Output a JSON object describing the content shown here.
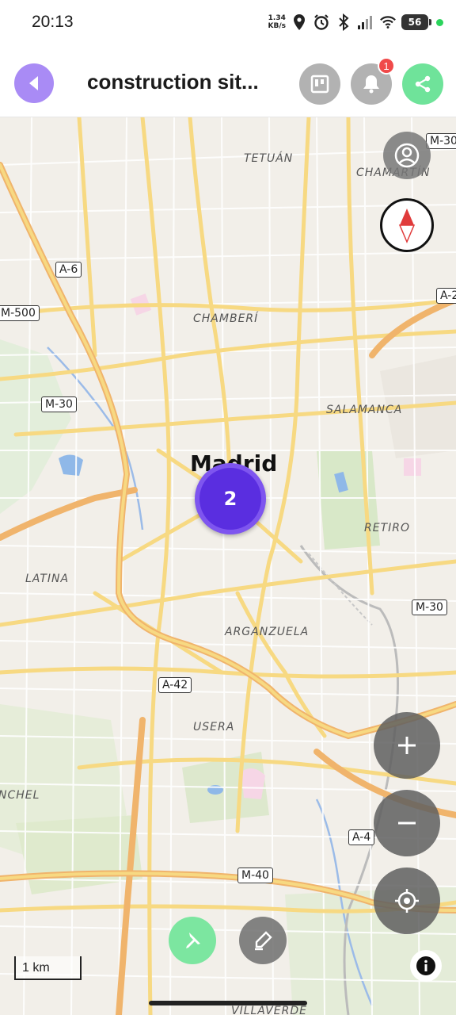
{
  "status_bar": {
    "time": "20:13",
    "net_speed_value": "1.34",
    "net_speed_unit": "KB/s",
    "battery": "56",
    "icons": [
      "location-icon",
      "alarm-icon",
      "bluetooth-icon",
      "signal-icon",
      "wifi-icon",
      "battery-icon"
    ]
  },
  "app_bar": {
    "title": "construction sit...",
    "notification_count": "1",
    "colors": {
      "back": "#a98bf5",
      "share": "#6fe39a",
      "neutral": "#b2b2b2"
    }
  },
  "map": {
    "city_label": "Madrid",
    "districts": [
      "TETUÁN",
      "CHAMARTÍN",
      "CHAMBERÍ",
      "SALAMANCA",
      "RETIRO",
      "LATINA",
      "ARGANZUELA",
      "USERA",
      "NCHEL",
      "VILLAVERDE"
    ],
    "road_shields": [
      "M-30",
      "A-6",
      "A-2",
      "M-500",
      "M-30",
      "M-30",
      "A-42",
      "A-4",
      "M-40"
    ],
    "cluster_count": "2",
    "scale_label": "1 km",
    "colors": {
      "cluster": "#5a2ee0",
      "roads": "#f7d982",
      "park": "#d8e8c8",
      "water": "#8fb8e8"
    }
  }
}
